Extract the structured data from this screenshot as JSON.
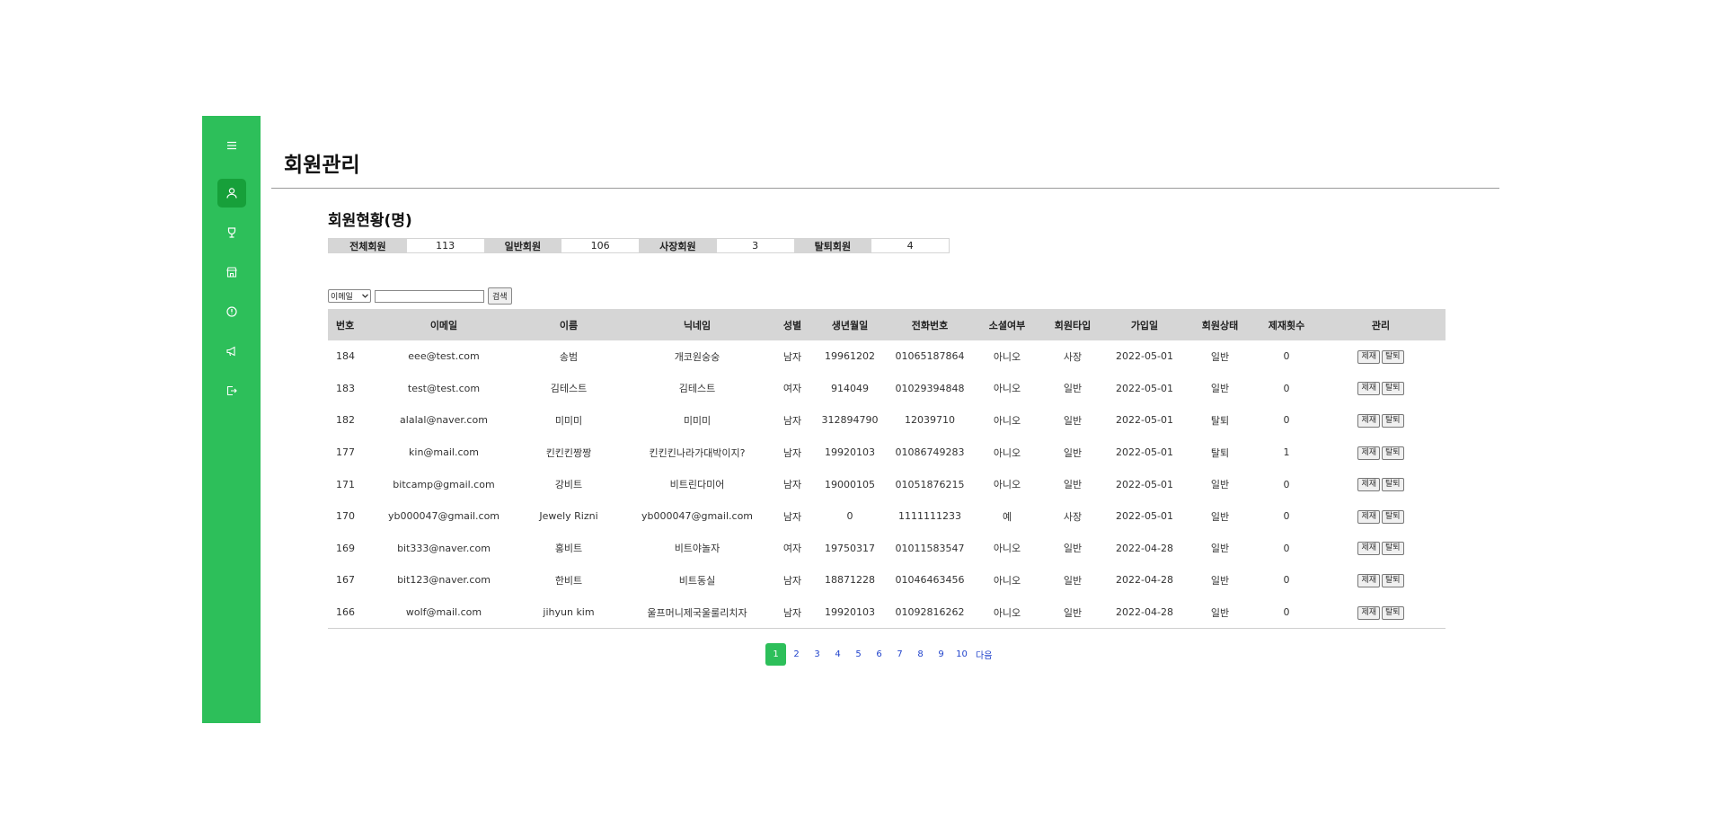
{
  "page": {
    "title": "회원관리",
    "section_title": "회원현황(명)"
  },
  "sidebar": {
    "items": [
      {
        "icon": "person-icon",
        "active": true
      },
      {
        "icon": "trophy-icon",
        "active": false
      },
      {
        "icon": "store-icon",
        "active": false
      },
      {
        "icon": "info-icon",
        "active": false
      },
      {
        "icon": "megaphone-icon",
        "active": false
      },
      {
        "icon": "logout-icon",
        "active": false
      }
    ]
  },
  "stats": [
    {
      "label": "전체회원",
      "value": "113"
    },
    {
      "label": "일반회원",
      "value": "106"
    },
    {
      "label": "사장회원",
      "value": "3"
    },
    {
      "label": "탈퇴회원",
      "value": "4"
    }
  ],
  "search": {
    "select_value": "이메일",
    "input_value": "",
    "button_label": "검색"
  },
  "table": {
    "headers": [
      "번호",
      "이메일",
      "이름",
      "닉네임",
      "성별",
      "생년월일",
      "전화번호",
      "소셜여부",
      "회원타입",
      "가입일",
      "회원상태",
      "제재횟수",
      "관리"
    ],
    "rows": [
      [
        "184",
        "eee@test.com",
        "송범",
        "개코원숭숭",
        "남자",
        "19961202",
        "01065187864",
        "아니오",
        "사장",
        "2022-05-01",
        "일반",
        "0"
      ],
      [
        "183",
        "test@test.com",
        "김테스트",
        "김테스트",
        "여자",
        "914049",
        "01029394848",
        "아니오",
        "일반",
        "2022-05-01",
        "일반",
        "0"
      ],
      [
        "182",
        "alalal@naver.com",
        "미미미",
        "미미미",
        "남자",
        "312894790",
        "12039710",
        "아니오",
        "일반",
        "2022-05-01",
        "탈퇴",
        "0"
      ],
      [
        "177",
        "kin@mail.com",
        "킨킨킨짱짱",
        "킨킨킨나라가대박이지?",
        "남자",
        "19920103",
        "01086749283",
        "아니오",
        "일반",
        "2022-05-01",
        "탈퇴",
        "1"
      ],
      [
        "171",
        "bitcamp@gmail.com",
        "강비트",
        "비트린다미어",
        "남자",
        "19000105",
        "01051876215",
        "아니오",
        "일반",
        "2022-05-01",
        "일반",
        "0"
      ],
      [
        "170",
        "yb000047@gmail.com",
        "Jewely Rizni",
        "yb000047@gmail.com",
        "남자",
        "0",
        "1111111233",
        "예",
        "사장",
        "2022-05-01",
        "일반",
        "0"
      ],
      [
        "169",
        "bit333@naver.com",
        "홍비트",
        "비트야놀자",
        "여자",
        "19750317",
        "01011583547",
        "아니오",
        "일반",
        "2022-04-28",
        "일반",
        "0"
      ],
      [
        "167",
        "bit123@naver.com",
        "한비트",
        "비트동실",
        "남자",
        "18871228",
        "01046463456",
        "아니오",
        "일반",
        "2022-04-28",
        "일반",
        "0"
      ],
      [
        "166",
        "wolf@mail.com",
        "jihyun kim",
        "울프머니제국울룰리치자",
        "남자",
        "19920103",
        "01092816262",
        "아니오",
        "일반",
        "2022-04-28",
        "일반",
        "0"
      ]
    ],
    "action_labels": [
      "제재",
      "탈퇴"
    ]
  },
  "pagination": {
    "pages": [
      "1",
      "2",
      "3",
      "4",
      "5",
      "6",
      "7",
      "8",
      "9",
      "10"
    ],
    "current": "1",
    "next_label": "다음"
  },
  "colors": {
    "accent": "#2dbf5a",
    "accent_dark": "#17a03a",
    "header_bg": "#d6d6d6",
    "link": "#2244cc",
    "highlight_text": "#8b2f8b"
  }
}
